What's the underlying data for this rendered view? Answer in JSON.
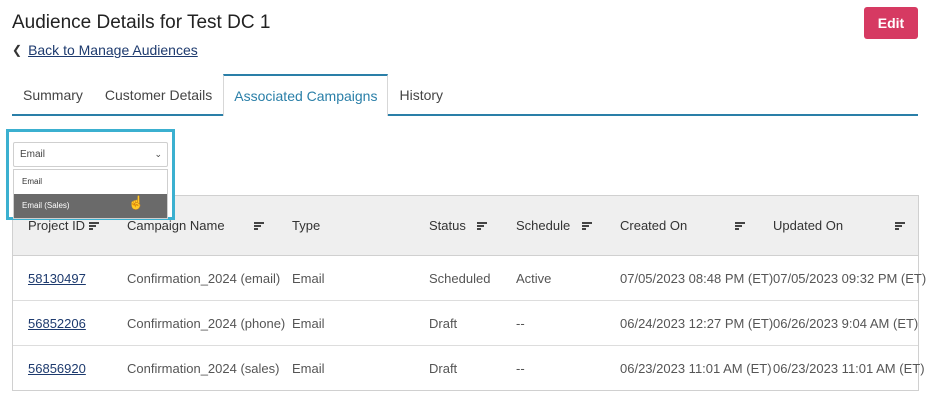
{
  "header": {
    "title": "Audience Details for Test DC 1",
    "edit_label": "Edit",
    "back_label": "Back to Manage Audiences"
  },
  "tabs": [
    {
      "label": "Summary"
    },
    {
      "label": "Customer Details"
    },
    {
      "label": "Associated Campaigns"
    },
    {
      "label": "History"
    }
  ],
  "active_tab": "Associated Campaigns",
  "filter": {
    "selected": "Email",
    "options": [
      {
        "label": "Email"
      },
      {
        "label": "Email (Sales)"
      }
    ],
    "hovered_option": "Email (Sales)"
  },
  "table": {
    "columns": [
      "Project ID",
      "Campaign Name",
      "Type",
      "Status",
      "Schedule",
      "Created On",
      "Updated On"
    ],
    "rows": [
      {
        "project_id": "58130497",
        "campaign_name": "Confirmation_2024 (email)",
        "type": "Email",
        "status": "Scheduled",
        "schedule": "Active",
        "created_on": "07/05/2023 08:48 PM (ET)",
        "updated_on": "07/05/2023 09:32 PM (ET)"
      },
      {
        "project_id": "56852206",
        "campaign_name": "Confirmation_2024 (phone)",
        "type": "Email",
        "status": "Draft",
        "schedule": "--",
        "created_on": "06/24/2023 12:27 PM (ET)",
        "updated_on": "06/26/2023 9:04 AM (ET)"
      },
      {
        "project_id": "56856920",
        "campaign_name": "Confirmation_2024 (sales)",
        "type": "Email",
        "status": "Draft",
        "schedule": "--",
        "created_on": "06/23/2023 11:01 AM (ET)",
        "updated_on": "06/23/2023 11:01 AM (ET)"
      }
    ]
  },
  "colors": {
    "accent": "#2a7fa8",
    "edit_button": "#d63a62",
    "highlight_border": "#3bb0d0",
    "link": "#1d3a6e"
  }
}
